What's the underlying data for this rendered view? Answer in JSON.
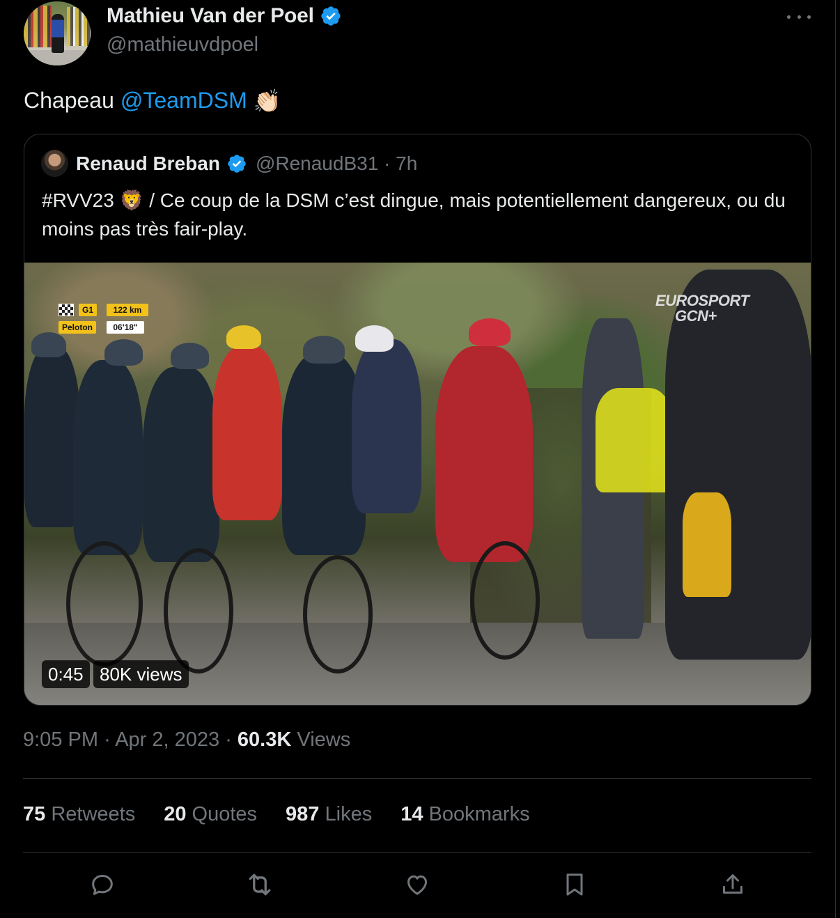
{
  "author": {
    "name": "Mathieu Van der Poel",
    "handle": "@mathieuvdpoel",
    "verified": true
  },
  "tweet": {
    "text_prefix": "Chapeau",
    "mention": "@TeamDSM",
    "emoji": "👏🏻"
  },
  "quoted": {
    "name": "Renaud Breban",
    "meta": "@RenaudB31 · 7h",
    "text": "#RVV23 🦁 / Ce coup de la DSM c’est dingue, mais potentiellement dangereux, ou du moins pas très fair-play.",
    "video": {
      "duration": "0:45",
      "views": "80K views",
      "overlay": {
        "g1": "G1",
        "distance": "122 km",
        "group": "Peloton",
        "gap": "06'18\"",
        "broadcaster_line1": "EUROSPORT",
        "broadcaster_line2": "GCN+"
      }
    }
  },
  "timestamp": {
    "time": "9:05 PM",
    "date": "Apr 2, 2023",
    "views_count": "60.3K",
    "views_label": "Views"
  },
  "stats": [
    {
      "count": "75",
      "label": "Retweets"
    },
    {
      "count": "20",
      "label": "Quotes"
    },
    {
      "count": "987",
      "label": "Likes"
    },
    {
      "count": "14",
      "label": "Bookmarks"
    }
  ],
  "colors": {
    "background": "#000000",
    "text": "#e7e9ea",
    "muted": "#71767b",
    "accent": "#1d9bf0",
    "border": "#2f3336"
  },
  "icons": [
    "verified-badge-icon",
    "more-icon",
    "reply-icon",
    "retweet-icon",
    "like-icon",
    "bookmark-icon",
    "share-icon"
  ]
}
